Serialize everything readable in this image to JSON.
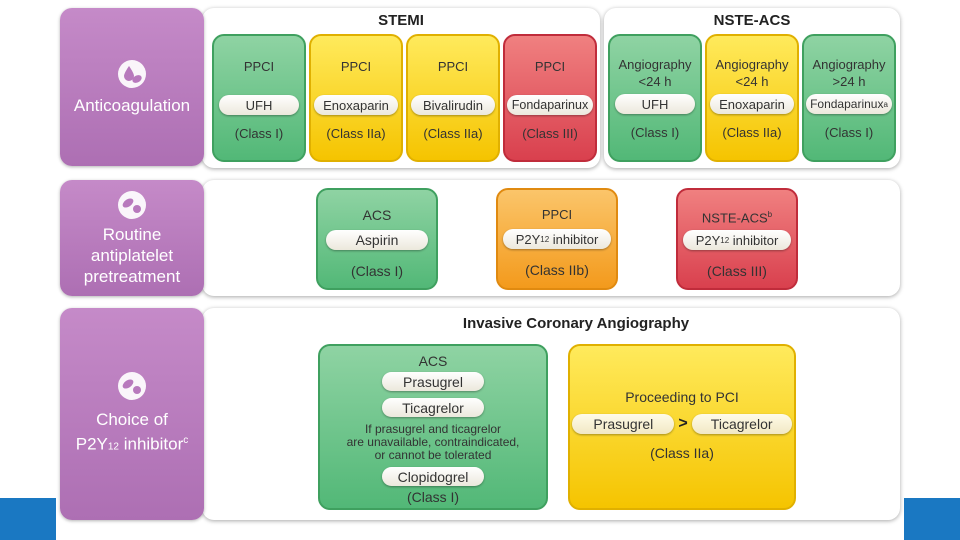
{
  "rows": {
    "anticoagulation": {
      "label": "Anticoagulation",
      "icon": "drop-pill-icon"
    },
    "pretreatment": {
      "label_lines": [
        "Routine",
        "antiplatelet",
        "pretreatment"
      ],
      "icon": "pills-icon"
    },
    "choice": {
      "label_line1": "Choice of",
      "label_p2y": "P2Y",
      "label_sub": "12",
      "label_rest": " inhibitor",
      "label_sup": "c",
      "icon": "pills-icon"
    }
  },
  "stemi": {
    "title": "STEMI",
    "boxes": [
      {
        "setting": "PPCI",
        "drug": "UFH",
        "cls": "(Class I)",
        "color": "green"
      },
      {
        "setting": "PPCI",
        "drug": "Enoxaparin",
        "cls": "(Class IIa)",
        "color": "yellow"
      },
      {
        "setting": "PPCI",
        "drug": "Bivalirudin",
        "cls": "(Class IIa)",
        "color": "yellow"
      },
      {
        "setting": "PPCI",
        "drug": "Fondaparinux",
        "cls": "(Class III)",
        "color": "red"
      }
    ]
  },
  "nste": {
    "title": "NSTE-ACS",
    "boxes": [
      {
        "setting1": "Angiography",
        "setting2": "<24 h",
        "drug": "UFH",
        "drug_sup": "",
        "cls": "(Class I)",
        "color": "green"
      },
      {
        "setting1": "Angiography",
        "setting2": "<24 h",
        "drug": "Enoxaparin",
        "drug_sup": "",
        "cls": "(Class IIa)",
        "color": "yellow"
      },
      {
        "setting1": "Angiography",
        "setting2": ">24 h",
        "drug": "Fondaparinux",
        "drug_sup": "a",
        "cls": "(Class I)",
        "color": "green"
      }
    ]
  },
  "pretreat": {
    "acs": {
      "title": "ACS",
      "drug": "Aspirin",
      "cls": "(Class I)"
    },
    "ppci": {
      "title": "PPCI",
      "drug_p2y": "P2Y",
      "drug_sub": "12",
      "drug_rest": " inhibitor",
      "cls": "(Class IIb)"
    },
    "nste": {
      "title": "NSTE-ACS",
      "title_sup": "b",
      "drug_p2y": "P2Y",
      "drug_sub": "12",
      "drug_rest": " inhibitor",
      "cls": "(Class III)"
    }
  },
  "ica": {
    "title": "Invasive Coronary Angiography",
    "acs": {
      "title": "ACS",
      "drug1": "Prasugrel",
      "drug2": "Ticagrelor",
      "note_lines": [
        "If prasugrel and ticagrelor",
        "are unavailable, contraindicated,",
        "or cannot be tolerated"
      ],
      "drug3": "Clopidogrel",
      "cls": "(Class I)"
    },
    "pci": {
      "title": "Proceeding to PCI",
      "drug_left": "Prasugrel",
      "compare": ">",
      "drug_right": "Ticagrelor",
      "cls": "(Class IIa)"
    }
  },
  "colors": {
    "green": "#52b877",
    "yellow": "#f5c400",
    "red": "#d9404e",
    "orange": "#f39a1c",
    "purple": "#b879bd",
    "blue_bar": "#1a78c2"
  }
}
